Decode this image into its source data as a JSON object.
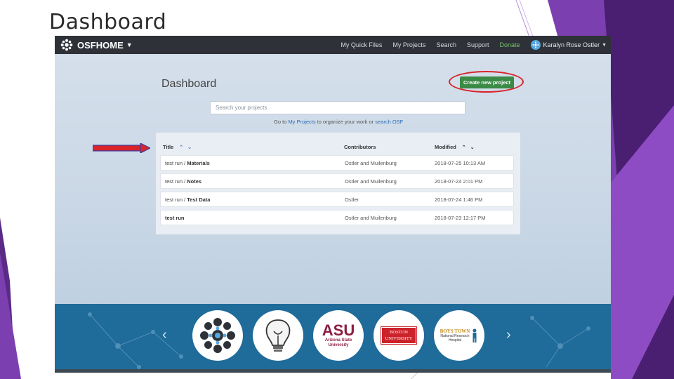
{
  "slide": {
    "title": "Dashboard"
  },
  "navbar": {
    "brand_osf": "OSF",
    "brand_home": "HOME",
    "links": [
      "My Quick Files",
      "My Projects",
      "Search",
      "Support",
      "Donate"
    ],
    "user_name": "Karalyn Rose Ostler"
  },
  "dashboard": {
    "heading": "Dashboard",
    "create_button": "Create new project",
    "search_placeholder": "Search your projects",
    "hint_prefix": "Go to ",
    "hint_link1": "My Projects",
    "hint_middle": " to organize your work or ",
    "hint_link2": "search OSF"
  },
  "table": {
    "columns": [
      "Title",
      "Contributors",
      "Modified"
    ],
    "rows": [
      {
        "title_prefix": "test run / ",
        "title_bold": "Materials",
        "contributors": "Ostler and Muilenburg",
        "modified": "2018-07-25 10:13 AM"
      },
      {
        "title_prefix": "test run / ",
        "title_bold": "Notes",
        "contributors": "Ostler and Muilenburg",
        "modified": "2018-07-24 2:01 PM"
      },
      {
        "title_prefix": "test run / ",
        "title_bold": "Test Data",
        "contributors": "Ostler",
        "modified": "2018-07-24 1:46 PM"
      },
      {
        "title_prefix": "",
        "title_bold": "test run",
        "contributors": "Ostler and Muilenburg",
        "modified": "2018-07-23 12:17 PM"
      }
    ]
  },
  "footer": {
    "asu_mark": "ASU",
    "asu_line1": "Arizona State",
    "asu_line2": "University",
    "bu_line1": "BOSTON",
    "bu_line2": "UNIVERSITY",
    "bt_line1": "BOYS TOWN",
    "bt_line2": "National Research",
    "bt_line3": "Hospital"
  },
  "colors": {
    "accent_green": "#3a8a45",
    "annotation_red": "#d9232a",
    "navbar_bg": "#2e3238",
    "footer_bg": "#1f6b9a",
    "slide_purple": "#5b2a86"
  },
  "icons": [
    "osf-logo-icon",
    "caret-down-icon",
    "user-avatar-icon",
    "sort-asc-icon",
    "sort-desc-icon",
    "chevron-left-icon",
    "chevron-right-icon",
    "red-arrow-icon"
  ]
}
